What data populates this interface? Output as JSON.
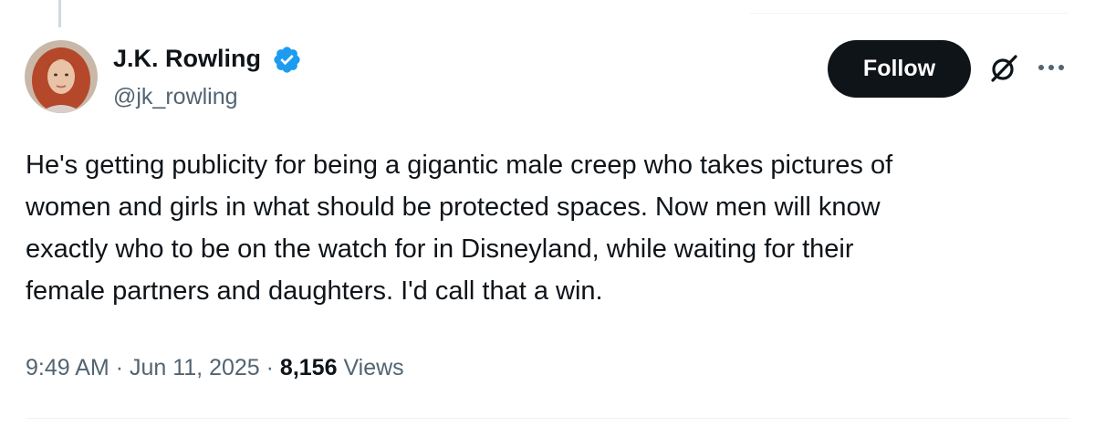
{
  "author": {
    "display_name": "J.K. Rowling",
    "handle": "@jk_rowling",
    "verified": true
  },
  "actions": {
    "follow_label": "Follow",
    "icons": [
      "grok-icon",
      "more-options-icon",
      "verified-badge-icon"
    ]
  },
  "tweet": {
    "lines": [
      "He's getting publicity for being a gigantic male creep who takes pictures of",
      "women and girls in what should be protected spaces. Now men will know",
      "exactly who to be on the watch for in Disneyland, while waiting for their",
      "female partners and daughters. I'd call that a win."
    ]
  },
  "meta": {
    "time": "9:49 AM",
    "separator": "·",
    "date": "Jun 11, 2025",
    "views_count": "8,156",
    "views_label": "Views"
  },
  "colors": {
    "text_primary": "#0f1419",
    "text_secondary": "#536471",
    "follow_bg": "#0f1419",
    "verified": "#1d9bf0",
    "divider": "#eff3f4"
  }
}
